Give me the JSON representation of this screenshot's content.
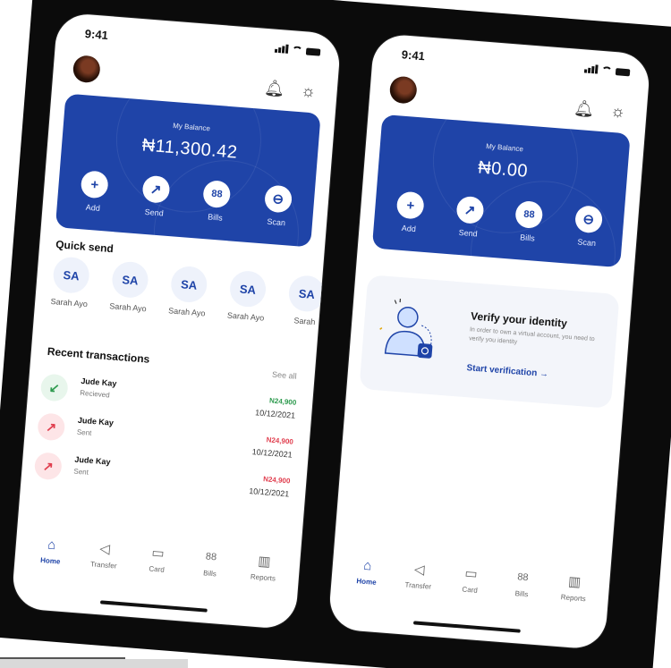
{
  "colors": {
    "brand": "#1f44a8",
    "received": "#2d9a4e",
    "sent": "#e03e4e"
  },
  "screen1": {
    "status": {
      "time": "9:41"
    },
    "balance": {
      "label": "My Balance",
      "amount": "₦11,300.42"
    },
    "actions": [
      {
        "label": "Add",
        "icon": "plus-icon",
        "glyph": "+"
      },
      {
        "label": "Send",
        "icon": "arrow-up-right-icon",
        "glyph": "↗"
      },
      {
        "label": "Bills",
        "icon": "grid-icon",
        "glyph": "88"
      },
      {
        "label": "Scan",
        "icon": "scan-icon",
        "glyph": "⊖"
      }
    ],
    "quick_send": {
      "title": "Quick send",
      "contacts": [
        {
          "initials": "SA",
          "name": "Sarah Ayo"
        },
        {
          "initials": "SA",
          "name": "Sarah Ayo"
        },
        {
          "initials": "SA",
          "name": "Sarah Ayo"
        },
        {
          "initials": "SA",
          "name": "Sarah Ayo"
        },
        {
          "initials": "SA",
          "name": "Sarah"
        }
      ]
    },
    "recent": {
      "title": "Recent transactions",
      "see_all": "See all",
      "items": [
        {
          "name": "Jude Kay",
          "status": "Recieved",
          "amount": "N24,900",
          "date": "10/12/2021",
          "type": "in"
        },
        {
          "name": "Jude Kay",
          "status": "Sent",
          "amount": "N24,900",
          "date": "10/12/2021",
          "type": "out"
        },
        {
          "name": "Jude Kay",
          "status": "Sent",
          "amount": "N24,900",
          "date": "10/12/2021",
          "type": "out"
        }
      ]
    }
  },
  "screen2": {
    "status": {
      "time": "9:41"
    },
    "balance": {
      "label": "My Balance",
      "amount": "₦0.00"
    },
    "actions": [
      {
        "label": "Add",
        "icon": "plus-icon",
        "glyph": "+"
      },
      {
        "label": "Send",
        "icon": "arrow-up-right-icon",
        "glyph": "↗"
      },
      {
        "label": "Bills",
        "icon": "grid-icon",
        "glyph": "88"
      },
      {
        "label": "Scan",
        "icon": "scan-icon",
        "glyph": "⊖"
      }
    ],
    "verify": {
      "title": "Verify your identity",
      "description": "In order to own a virtual account, you need to verify you identity",
      "link": "Start verification →"
    }
  },
  "nav": [
    {
      "label": "Home",
      "icon": "home-icon",
      "glyph": "⌂"
    },
    {
      "label": "Transfer",
      "icon": "send-icon",
      "glyph": "◁"
    },
    {
      "label": "Card",
      "icon": "card-icon",
      "glyph": "▭"
    },
    {
      "label": "Bills",
      "icon": "grid-icon",
      "glyph": "88"
    },
    {
      "label": "Reports",
      "icon": "chart-icon",
      "glyph": "▥"
    }
  ]
}
